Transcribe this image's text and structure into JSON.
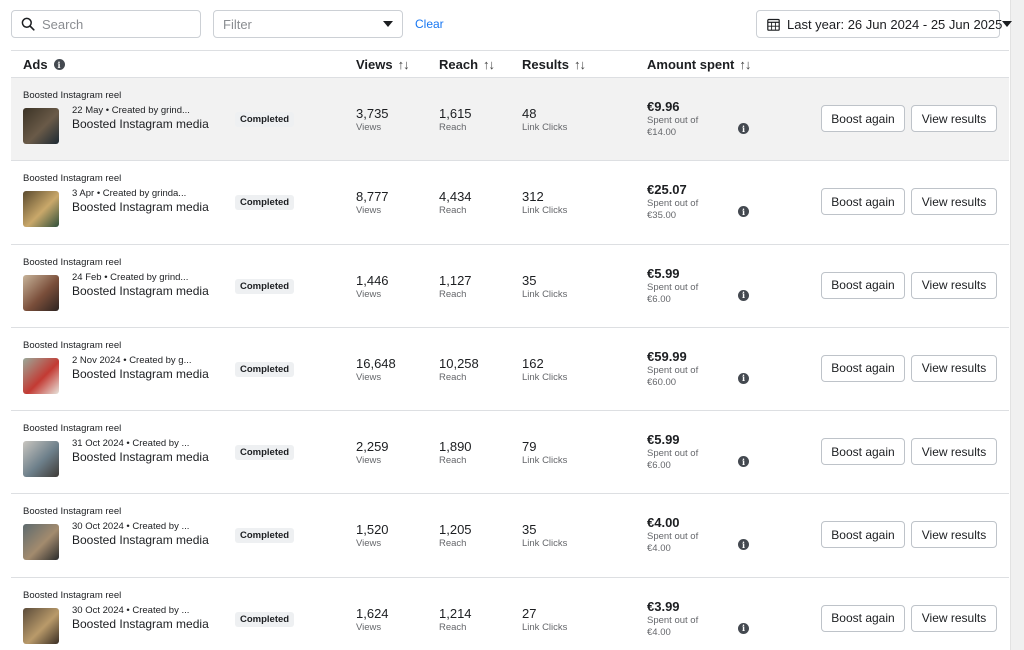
{
  "toolbar": {
    "search_placeholder": "Search",
    "filter_placeholder": "Filter",
    "clear_label": "Clear",
    "date_range": "Last year: 26 Jun 2024 - 25 Jun 2025"
  },
  "table": {
    "columns": {
      "ads": "Ads",
      "views": "Views",
      "reach": "Reach",
      "results": "Results",
      "amount": "Amount spent"
    },
    "sort_icon": "↑↓",
    "info_icon": "i",
    "rows": [
      {
        "type": "Boosted Instagram reel",
        "meta": "22 May • Created by grind...",
        "name": "Boosted Instagram media",
        "status": "Completed",
        "views": "3,735",
        "views_label": "Views",
        "reach": "1,615",
        "reach_label": "Reach",
        "results": "48",
        "results_label": "Link Clicks",
        "amount": "€9.96",
        "spent_of": "Spent out of €14.00",
        "boost_label": "Boost again",
        "view_label": "View results"
      },
      {
        "type": "Boosted Instagram reel",
        "meta": "3 Apr • Created by grinda...",
        "name": "Boosted Instagram media",
        "status": "Completed",
        "views": "8,777",
        "views_label": "Views",
        "reach": "4,434",
        "reach_label": "Reach",
        "results": "312",
        "results_label": "Link Clicks",
        "amount": "€25.07",
        "spent_of": "Spent out of €35.00",
        "boost_label": "Boost again",
        "view_label": "View results"
      },
      {
        "type": "Boosted Instagram reel",
        "meta": "24 Feb • Created by grind...",
        "name": "Boosted Instagram media",
        "status": "Completed",
        "views": "1,446",
        "views_label": "Views",
        "reach": "1,127",
        "reach_label": "Reach",
        "results": "35",
        "results_label": "Link Clicks",
        "amount": "€5.99",
        "spent_of": "Spent out of €6.00",
        "boost_label": "Boost again",
        "view_label": "View results"
      },
      {
        "type": "Boosted Instagram reel",
        "meta": "2 Nov 2024 • Created by g...",
        "name": "Boosted Instagram media",
        "status": "Completed",
        "views": "16,648",
        "views_label": "Views",
        "reach": "10,258",
        "reach_label": "Reach",
        "results": "162",
        "results_label": "Link Clicks",
        "amount": "€59.99",
        "spent_of": "Spent out of €60.00",
        "boost_label": "Boost again",
        "view_label": "View results"
      },
      {
        "type": "Boosted Instagram reel",
        "meta": "31 Oct 2024 • Created by ...",
        "name": "Boosted Instagram media",
        "status": "Completed",
        "views": "2,259",
        "views_label": "Views",
        "reach": "1,890",
        "reach_label": "Reach",
        "results": "79",
        "results_label": "Link Clicks",
        "amount": "€5.99",
        "spent_of": "Spent out of €6.00",
        "boost_label": "Boost again",
        "view_label": "View results"
      },
      {
        "type": "Boosted Instagram reel",
        "meta": "30 Oct 2024 • Created by ...",
        "name": "Boosted Instagram media",
        "status": "Completed",
        "views": "1,520",
        "views_label": "Views",
        "reach": "1,205",
        "reach_label": "Reach",
        "results": "35",
        "results_label": "Link Clicks",
        "amount": "€4.00",
        "spent_of": "Spent out of €4.00",
        "boost_label": "Boost again",
        "view_label": "View results"
      },
      {
        "type": "Boosted Instagram reel",
        "meta": "30 Oct 2024 • Created by ...",
        "name": "Boosted Instagram media",
        "status": "Completed",
        "views": "1,624",
        "views_label": "Views",
        "reach": "1,214",
        "reach_label": "Reach",
        "results": "27",
        "results_label": "Link Clicks",
        "amount": "€3.99",
        "spent_of": "Spent out of €4.00",
        "boost_label": "Boost again",
        "view_label": "View results"
      }
    ]
  },
  "colors": {
    "accent": "#1877f2",
    "row_highlight": "#f2f2f2",
    "thumbnails": [
      [
        "#3b3326",
        "#6a5a48",
        "#1d2a33"
      ],
      [
        "#5a4a2e",
        "#c9a86a",
        "#2f4f3a"
      ],
      [
        "#c8b49a",
        "#7a4e3a",
        "#2d2320"
      ],
      [
        "#9aa99a",
        "#c33a33",
        "#e8e4dc"
      ],
      [
        "#c9c6c0",
        "#6d7f8a",
        "#3e3a36"
      ],
      [
        "#5d6a6e",
        "#a38b6e",
        "#2a2b2c"
      ],
      [
        "#5a4b3a",
        "#b99a6a",
        "#3a2e24"
      ]
    ]
  }
}
